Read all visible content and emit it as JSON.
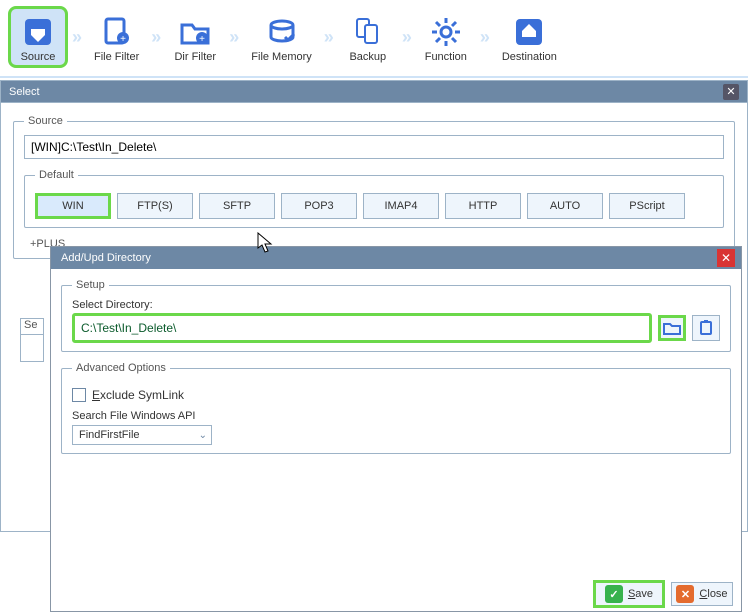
{
  "toolbar": {
    "items": [
      {
        "label": "Source"
      },
      {
        "label": "File Filter"
      },
      {
        "label": "Dir Filter"
      },
      {
        "label": "File Memory"
      },
      {
        "label": "Backup"
      },
      {
        "label": "Function"
      },
      {
        "label": "Destination"
      }
    ]
  },
  "select_dialog": {
    "title": "Select",
    "source_legend": "Source",
    "source_value": "[WIN]C:\\Test\\In_Delete\\",
    "default_legend": "Default",
    "default_buttons": [
      "WIN",
      "FTP(S)",
      "SFTP",
      "POP3",
      "IMAP4",
      "HTTP",
      "AUTO",
      "PScript"
    ],
    "plus_label": "+PLUS",
    "sel_prefix": "Se"
  },
  "addupd_dialog": {
    "title": "Add/Upd Directory",
    "setup_legend": "Setup",
    "select_dir_label": "Select Directory:",
    "dir_value": "C:\\Test\\In_Delete\\",
    "advanced_legend": "Advanced  Options",
    "exclude_symlink_label": "Exclude SymLink",
    "search_api_label": "Search File Windows API",
    "findfirstfile": "FindFirstFile",
    "save_label": "Save",
    "close_label": "Close"
  }
}
